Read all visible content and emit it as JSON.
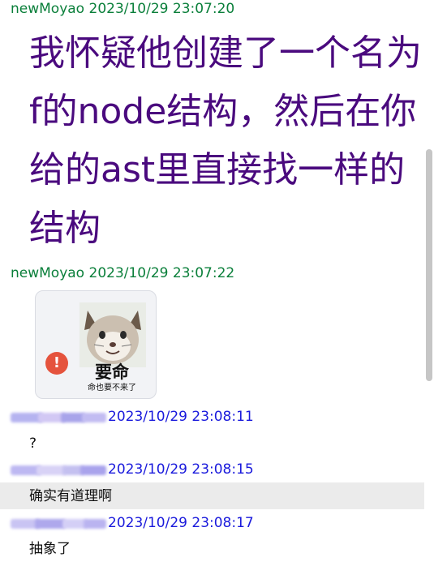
{
  "messages": [
    {
      "sender": "newMoyao",
      "time": "2023/10/29 23:07:20",
      "text_lines": [
        "我怀疑他创建了一个名为",
        "f的node结构，然后在你",
        "给的ast里直接找一样的",
        "结构"
      ]
    },
    {
      "sender": "newMoyao",
      "time": "2023/10/29 23:07:22",
      "sticker": {
        "caption": "要命",
        "subcaption": "命也要不来了",
        "status_icon": "!"
      }
    },
    {
      "sender": "",
      "time": "2023/10/29 23:08:11",
      "text": "?"
    },
    {
      "sender": "",
      "time": "2023/10/29 23:08:15",
      "text": "确实有道理啊"
    },
    {
      "sender": "",
      "time": "2023/10/29 23:08:17",
      "text": "抽象了"
    }
  ],
  "colors": {
    "own_header": "#0a7f3a",
    "other_header": "#1a1adc",
    "big_text": "#4a0a7e",
    "highlight_row": "#ebebeb",
    "warn": "#e5533d"
  },
  "icons": {
    "sticker_status": "error-exclamation-icon",
    "sticker_image": "cat-meme-icon"
  }
}
